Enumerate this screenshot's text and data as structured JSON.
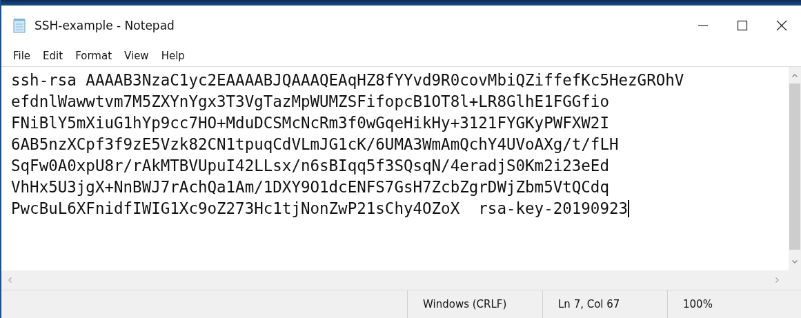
{
  "window": {
    "title": "SSH-example - Notepad"
  },
  "menu": [
    "File",
    "Edit",
    "Format",
    "View",
    "Help"
  ],
  "document": {
    "lines": [
      "ssh-rsa AAAAB3NzaC1yc2EAAAABJQAAAQEAqHZ8fYYvd9R0covMbiQZiffefKc5HezGROhV",
      "efdnlWawwtvm7M5ZXYnYgx3T3VgTazMpWUMZSFifopcB1OT8l+LR8GlhE1FGGfio",
      "FNiBlY5mXiuG1hYp9cc7HO+MduDCSMcNcRm3f0wGqeHikHy+3121FYGKyPWFXW2I",
      "6AB5nzXCpf3f9zE5Vzk82CN1tpuqCdVLmJG1cK/6UMA3WmAmQchY4UVoAXg/t/fLH",
      "SqFw0A0xpU8r/rAkMTBVUpuI42LLsx/n6sBIqq5f3SQsqN/4eradjS0Km2i23eEd",
      "VhHx5U3jgX+NnBWJ7rAchQa1Am/1DXY9O1dcENFS7GsH7ZcbZgrDWjZbm5VtQCdq",
      "PwcBuL6XFnidfIWIG1Xc9oZ273Hc1tjNonZwP21sChy4OZoX  rsa-key-20190923"
    ]
  },
  "status_bar": [
    "Windows (CRLF)",
    "Ln 7, Col 67",
    "100%"
  ]
}
